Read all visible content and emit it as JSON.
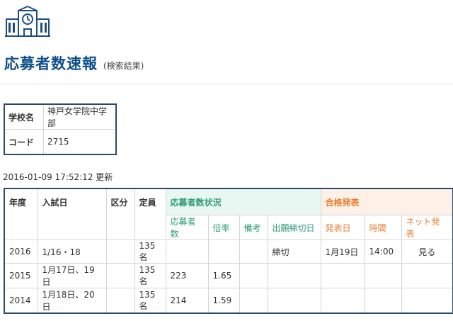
{
  "header": {
    "title": "応募者数速報",
    "subtitle": "(検索結果)"
  },
  "info": {
    "rows": [
      {
        "key": "学校名",
        "value": "神戸女学院中学部"
      },
      {
        "key": "コード",
        "value": "2715"
      }
    ]
  },
  "updated": "2016-01-09 17:52:12 更新",
  "table": {
    "headers": {
      "year": "年度",
      "exam_date": "入試日",
      "division": "区分",
      "capacity": "定員",
      "applicant_group": "応募者数状況",
      "result_group": "合格発表"
    },
    "subheaders": {
      "applicants": "応募者数",
      "ratio": "倍率",
      "notes": "備考",
      "deadline": "出願締切日",
      "announce_date": "発表日",
      "time": "時間",
      "net": "ネット発表"
    },
    "rows": [
      {
        "year": "2016",
        "exam_date": "1/16・18",
        "division": "",
        "capacity": "135名",
        "applicants": "",
        "ratio": "",
        "notes": "",
        "deadline": "締切",
        "announce_date": "1月19日",
        "time": "14:00",
        "net": "見る"
      },
      {
        "year": "2015",
        "exam_date": "1月17日、19日",
        "division": "",
        "capacity": "135名",
        "applicants": "223",
        "ratio": "1.65",
        "notes": "",
        "deadline": "",
        "announce_date": "",
        "time": "",
        "net": ""
      },
      {
        "year": "2014",
        "exam_date": "1月18日、20日",
        "division": "",
        "capacity": "135名",
        "applicants": "214",
        "ratio": "1.59",
        "notes": "",
        "deadline": "",
        "announce_date": "",
        "time": "",
        "net": ""
      }
    ]
  },
  "colors": {
    "brand": "#0d4f8b",
    "green": "#2f9b77",
    "orange": "#e77d2f"
  },
  "icons": {
    "logo": "school-building-clock-icon"
  }
}
